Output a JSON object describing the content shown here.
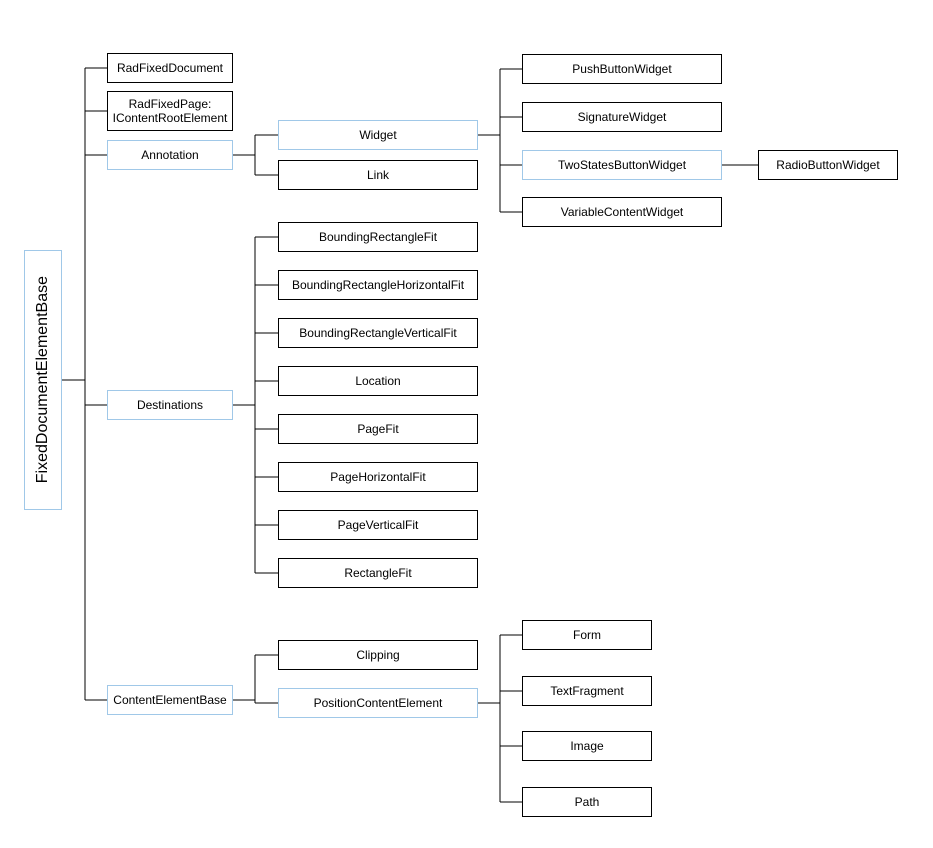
{
  "root": {
    "label": "FixedDocumentElementBase"
  },
  "col1": {
    "radFixedDocument": "RadFixedDocument",
    "radFixedPage": "RadFixedPage:\nIContentRootElement",
    "annotation": "Annotation",
    "destinations": "Destinations",
    "contentElementBase": "ContentElementBase"
  },
  "annotation_children": {
    "widget": "Widget",
    "link": "Link"
  },
  "widget_children": {
    "pushButton": "PushButtonWidget",
    "signature": "SignatureWidget",
    "twoStates": "TwoStatesButtonWidget",
    "variable": "VariableContentWidget"
  },
  "twoStates_children": {
    "radio": "RadioButtonWidget"
  },
  "destinations_children": {
    "boundingRectFit": "BoundingRectangleFit",
    "boundingRectHFit": "BoundingRectangleHorizontalFit",
    "boundingRectVFit": "BoundingRectangleVerticalFit",
    "location": "Location",
    "pageFit": "PageFit",
    "pageHFit": "PageHorizontalFit",
    "pageVFit": "PageVerticalFit",
    "rectangleFit": "RectangleFit"
  },
  "ceb_children": {
    "clipping": "Clipping",
    "positionContent": "PositionContentElement"
  },
  "pce_children": {
    "form": "Form",
    "textFragment": "TextFragment",
    "image": "Image",
    "path": "Path"
  }
}
